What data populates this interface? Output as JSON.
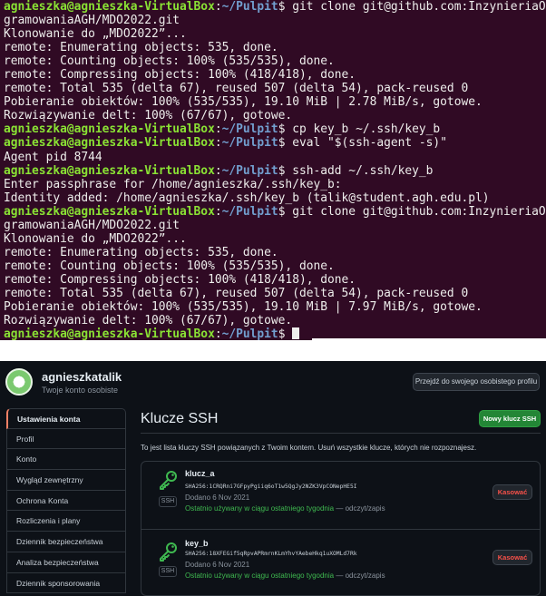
{
  "terminal": {
    "prompt_user": "agnieszka@agnieszka-VirtualBox",
    "prompt_path": "~/Pulpit",
    "prompt_sign": "$",
    "lines": [
      {
        "prompt": true,
        "cmd": "git clone git@github.com:InzynieriaOpro"
      },
      {
        "prompt": false,
        "text": "gramowaniaAGH/MDO2022.git"
      },
      {
        "prompt": false,
        "text": "Klonowanie do „MDO2022”..."
      },
      {
        "prompt": false,
        "text": "remote: Enumerating objects: 535, done."
      },
      {
        "prompt": false,
        "text": "remote: Counting objects: 100% (535/535), done."
      },
      {
        "prompt": false,
        "text": "remote: Compressing objects: 100% (418/418), done."
      },
      {
        "prompt": false,
        "text": "remote: Total 535 (delta 67), reused 507 (delta 54), pack-reused 0"
      },
      {
        "prompt": false,
        "text": "Pobieranie obiektów: 100% (535/535), 19.10 MiB | 2.78 MiB/s, gotowe."
      },
      {
        "prompt": false,
        "text": "Rozwiązywanie delt: 100% (67/67), gotowe."
      },
      {
        "prompt": true,
        "cmd": "cp key_b ~/.ssh/key_b"
      },
      {
        "prompt": true,
        "cmd": "eval \"$(ssh-agent -s)\""
      },
      {
        "prompt": false,
        "text": "Agent pid 8744"
      },
      {
        "prompt": true,
        "cmd": "ssh-add ~/.ssh/key_b"
      },
      {
        "prompt": false,
        "text": "Enter passphrase for /home/agnieszka/.ssh/key_b:"
      },
      {
        "prompt": false,
        "text": "Identity added: /home/agnieszka/.ssh/key_b (talik@student.agh.edu.pl)"
      },
      {
        "prompt": true,
        "cmd": "git clone git@github.com:InzynieriaOpro"
      },
      {
        "prompt": false,
        "text": "gramowaniaAGH/MDO2022.git"
      },
      {
        "prompt": false,
        "text": "Klonowanie do „MDO2022”..."
      },
      {
        "prompt": false,
        "text": "remote: Enumerating objects: 535, done."
      },
      {
        "prompt": false,
        "text": "remote: Counting objects: 100% (535/535), done."
      },
      {
        "prompt": false,
        "text": "remote: Compressing objects: 100% (418/418), done."
      },
      {
        "prompt": false,
        "text": "remote: Total 535 (delta 67), reused 507 (delta 54), pack-reused 0"
      },
      {
        "prompt": false,
        "text": "Pobieranie obiektów: 100% (535/535), 19.10 MiB | 7.97 MiB/s, gotowe."
      },
      {
        "prompt": false,
        "text": "Rozwiązywanie delt: 100% (67/67), gotowe."
      },
      {
        "prompt": true,
        "cmd": "",
        "cursor": true
      }
    ]
  },
  "github": {
    "username": "agnieszkatalik",
    "subtitle": "Twoje konto osobiste",
    "profile_button": "Przejdź do swojego osobistego profilu",
    "sidebar": [
      {
        "label": "Ustawienia konta",
        "active": true
      },
      {
        "label": "Profil"
      },
      {
        "label": "Konto"
      },
      {
        "label": "Wygląd zewnętrzny"
      },
      {
        "label": "Ochrona Konta"
      },
      {
        "label": "Rozliczenia i plany"
      },
      {
        "label": "Dziennik bezpieczeństwa"
      },
      {
        "label": "Analiza bezpieczeństwa"
      },
      {
        "label": "Dziennik sponsorowania"
      }
    ],
    "page_title": "Klucze SSH",
    "new_key_button": "Nowy klucz SSH",
    "description": "To jest lista kluczy SSH powiązanych z Twoim kontem. Usuń wszystkie klucze, których nie rozpoznajesz.",
    "keys": [
      {
        "name": "klucz_a",
        "fingerprint": "SHA256:1CRQRni7GFpyPgiiq6oT1w5QgJy2NZK3VpCONepHE5I",
        "date": "Dodano 6 Nov 2021",
        "usage_green": "Ostatnio używany w ciągu ostatniego tygodnia",
        "usage_rest": "— odczyt/zapis",
        "badge": "SSH",
        "delete_label": "Kasować"
      },
      {
        "name": "key_b",
        "fingerprint": "SHA256:18XFEGif5qRpvAPRmrnKLmYhvYAebeHkq1uXOMLd7Rk",
        "date": "Dodano 6 Nov 2021",
        "usage_green": "Ostatnio używany w ciągu ostatniego tygodnia",
        "usage_rest": "— odczyt/zapis",
        "badge": "SSH",
        "delete_label": "Kasować"
      }
    ],
    "colors": {
      "terminal_bg": "#300a24",
      "prompt_user": "#8ae234",
      "prompt_path": "#729fcf",
      "github_bg": "#0d1117",
      "primary_button": "#238636",
      "danger": "#f85149",
      "success_text": "#3fb950"
    }
  }
}
